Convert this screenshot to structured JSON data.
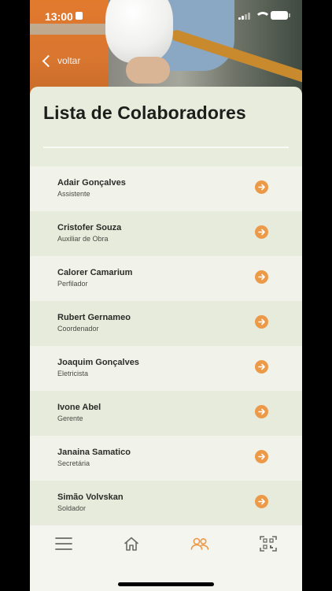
{
  "status_bar": {
    "time": "13:00"
  },
  "header": {
    "back_label": "voltar"
  },
  "page": {
    "title": "Lista de Colaboradores"
  },
  "colors": {
    "accent": "#ec9a48",
    "row_light": "#f1f3ea",
    "row_dark": "#e6ebdc",
    "card_bg": "#e7ecdd"
  },
  "employees": [
    {
      "name": "Adair Gonçalves",
      "role": "Assistente"
    },
    {
      "name": "Cristofer Souza",
      "role": "Auxiliar de Obra"
    },
    {
      "name": "Calorer Camarium",
      "role": "Perfilador"
    },
    {
      "name": "Rubert Gernameo",
      "role": "Coordenador"
    },
    {
      "name": "Joaquim Gonçalves",
      "role": "Eletricista"
    },
    {
      "name": "Ivone Abel",
      "role": "Gerente"
    },
    {
      "name": "Janaina Samatico",
      "role": "Secretária"
    },
    {
      "name": "Simão Volvskan",
      "role": "Soldador"
    }
  ],
  "tab_bar": {
    "items": [
      {
        "icon": "menu-icon"
      },
      {
        "icon": "home-icon"
      },
      {
        "icon": "people-icon",
        "active": true
      },
      {
        "icon": "qr-code-icon"
      }
    ]
  }
}
